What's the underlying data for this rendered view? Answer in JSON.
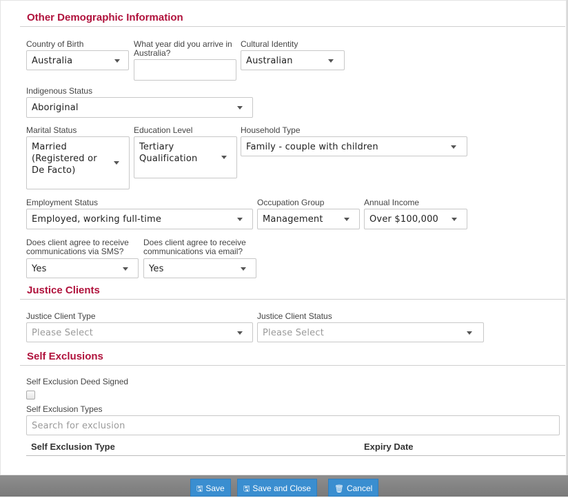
{
  "sections": {
    "other_demo": "Other Demographic Information",
    "justice": "Justice Clients",
    "self_exclusions": "Self Exclusions"
  },
  "fields": {
    "country_of_birth": {
      "label": "Country of Birth",
      "value": "Australia"
    },
    "year_arrived": {
      "label": "What year did you arrive in Australia?",
      "value": ""
    },
    "cultural_identity": {
      "label": "Cultural Identity",
      "value": "Australian"
    },
    "indigenous_status": {
      "label": "Indigenous Status",
      "value": "Aboriginal"
    },
    "marital_status": {
      "label": "Marital Status",
      "value": "Married (Registered or De Facto)"
    },
    "education_level": {
      "label": "Education Level",
      "value": "Tertiary Qualification"
    },
    "household_type": {
      "label": "Household Type",
      "value": "Family - couple with children"
    },
    "employment_status": {
      "label": "Employment Status",
      "value": "Employed, working full-time"
    },
    "occupation_group": {
      "label": "Occupation Group",
      "value": "Management"
    },
    "annual_income": {
      "label": "Annual Income",
      "value": "Over $100,000"
    },
    "sms_consent": {
      "label": "Does client agree to receive communications via SMS?",
      "value": "Yes"
    },
    "email_consent": {
      "label": "Does client agree to receive communications via email?",
      "value": "Yes"
    },
    "justice_client_type": {
      "label": "Justice Client Type",
      "value": "Please Select"
    },
    "justice_client_status": {
      "label": "Justice Client Status",
      "value": "Please Select"
    },
    "self_exclusion_deed": {
      "label": "Self Exclusion Deed Signed",
      "checked": false
    },
    "self_exclusion_types": {
      "label": "Self Exclusion Types",
      "placeholder": "Search for exclusion"
    }
  },
  "table": {
    "columns": [
      "Self Exclusion Type",
      "Expiry Date"
    ]
  },
  "buttons": {
    "save": "Save",
    "save_close": "Save and Close",
    "cancel": "Cancel"
  },
  "icons": {
    "save": "floppy-disk-icon",
    "save_close": "floppy-disk-icon",
    "cancel": "trash-icon"
  }
}
